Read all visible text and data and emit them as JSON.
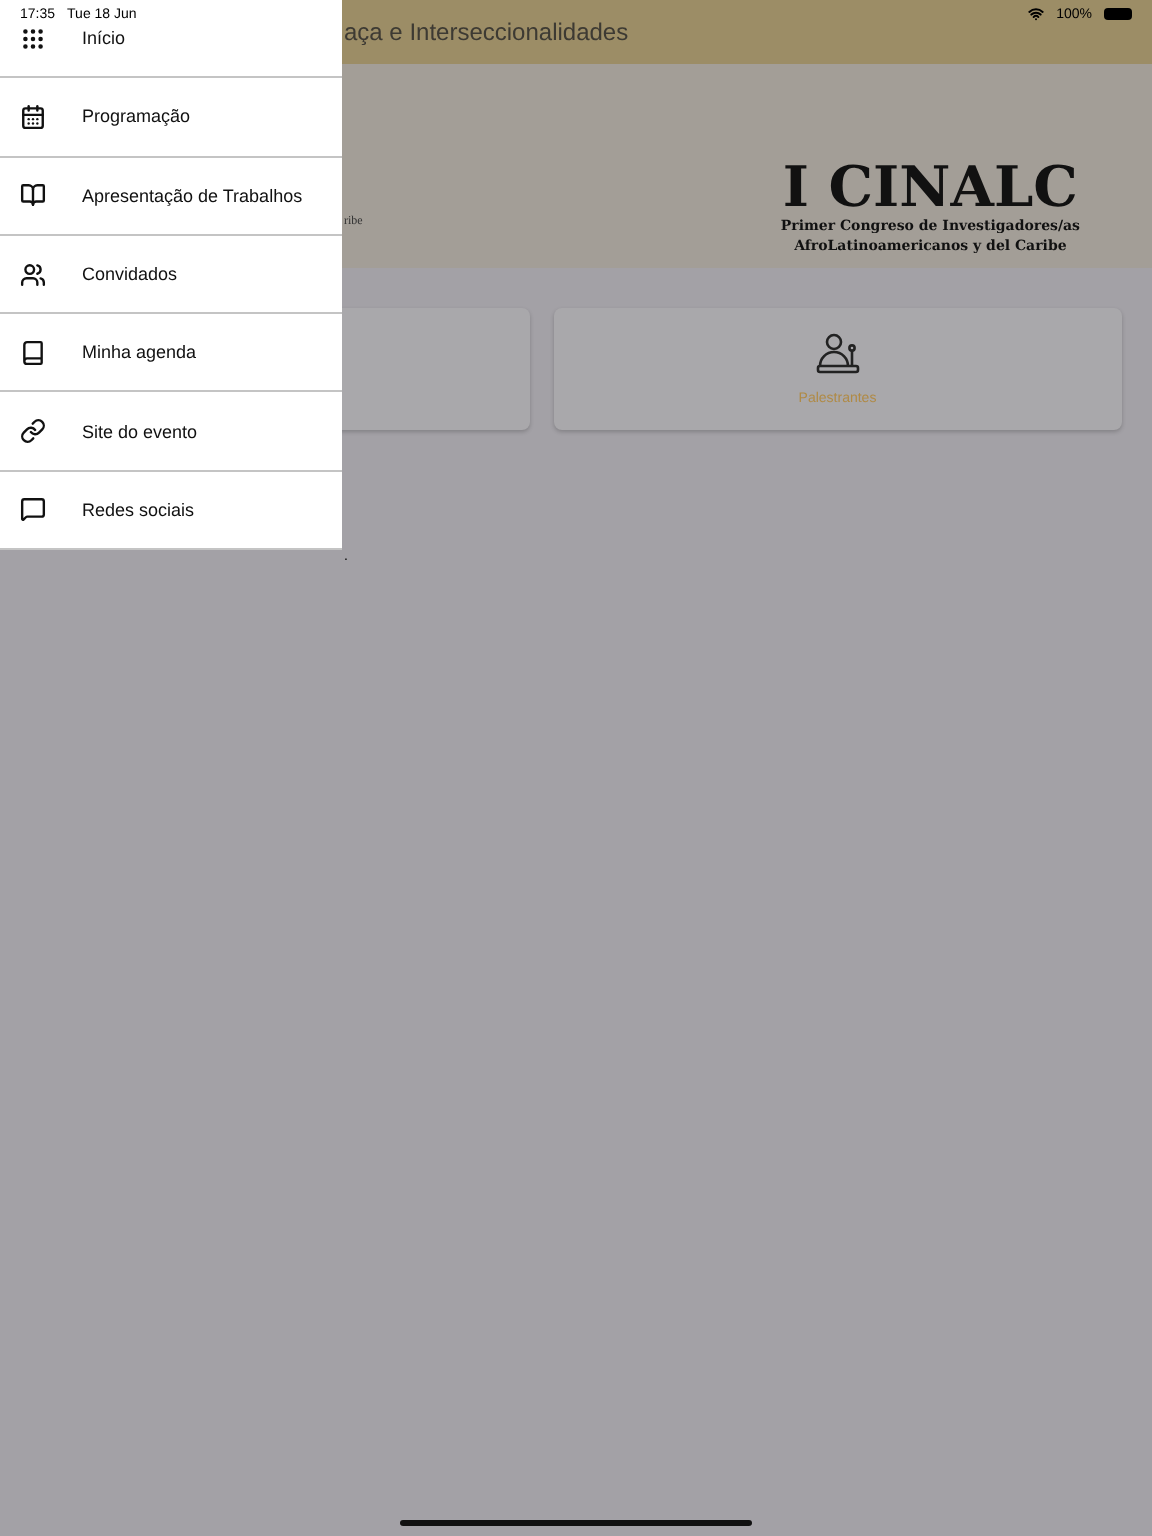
{
  "status_bar": {
    "time": "17:35",
    "date": "Tue 18 Jun",
    "battery": "100%"
  },
  "app_bar": {
    "title": "aça e Interseccionalidades"
  },
  "banner": {
    "subtitle_fragment": "ribe",
    "logo_title": "I CINALC",
    "logo_line_1": "Primer Congreso de Investigadores/as",
    "logo_line_2": "AfroLatinoamericanos y del Caribe"
  },
  "cards": [
    {
      "kind": "blank"
    },
    {
      "kind": "speakers",
      "label": "Palestrantes"
    }
  ],
  "footer_fragment": ".",
  "drawer": {
    "items": [
      {
        "kind": "grid",
        "label": "Início"
      },
      {
        "kind": "calendar",
        "label": "Programação"
      },
      {
        "kind": "book",
        "label": "Apresentação de Trabalhos"
      },
      {
        "kind": "people",
        "label": "Convidados"
      },
      {
        "kind": "agenda",
        "label": "Minha agenda"
      },
      {
        "kind": "link",
        "label": "Site do evento"
      },
      {
        "kind": "chat",
        "label": "Redes sociais"
      }
    ]
  }
}
